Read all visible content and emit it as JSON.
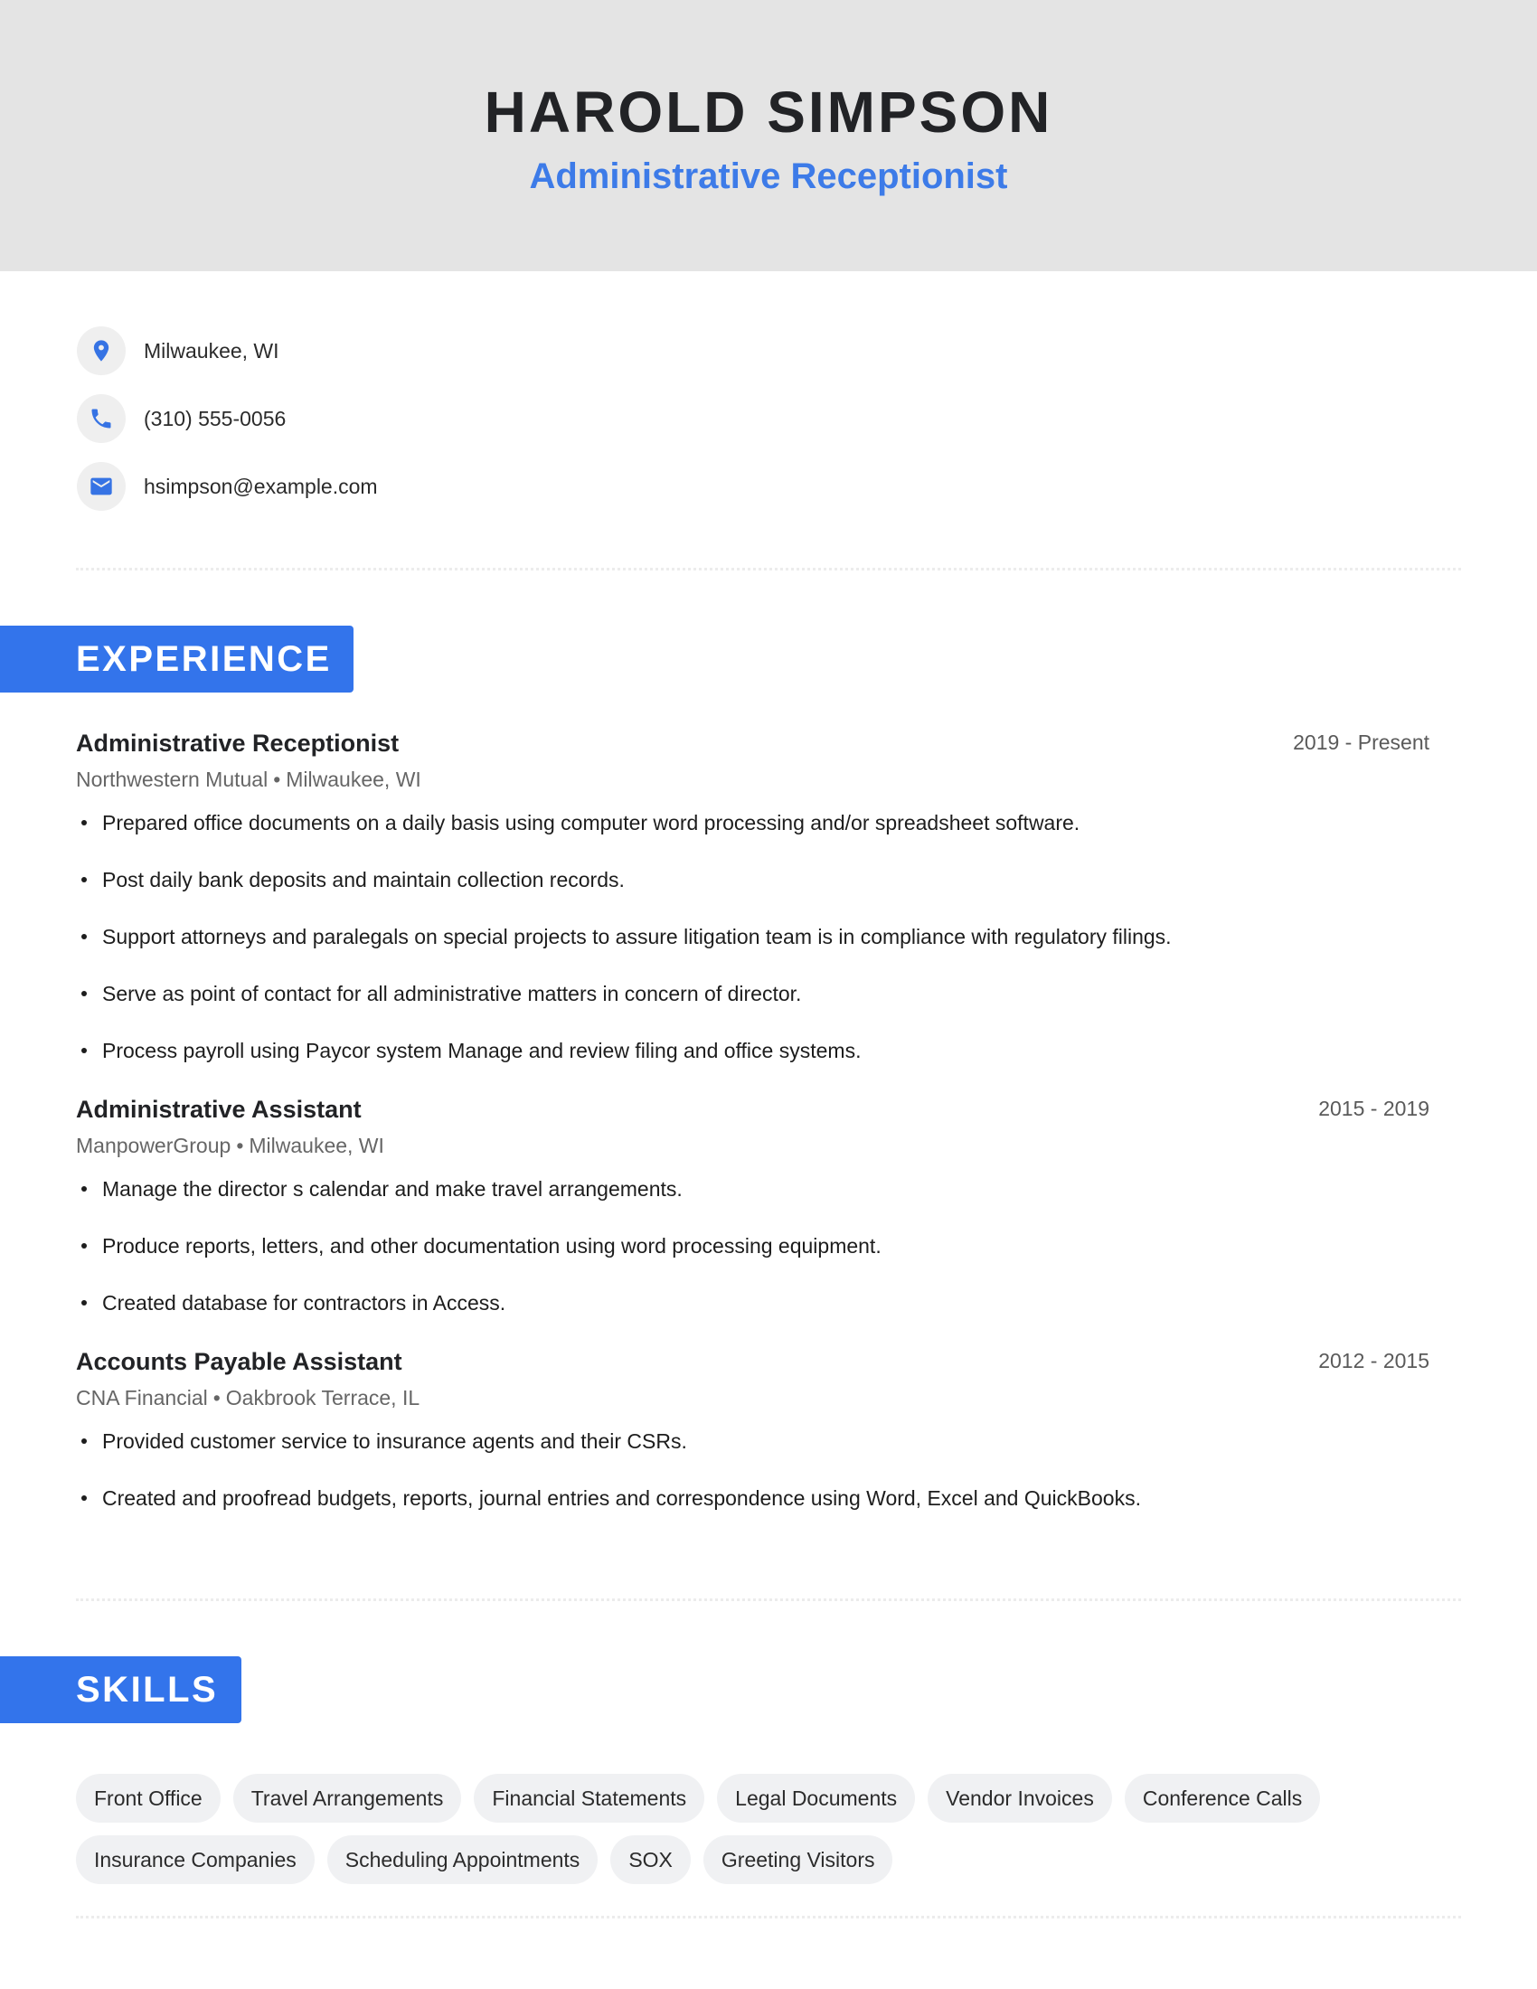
{
  "header": {
    "name": "HAROLD SIMPSON",
    "title": "Administrative Receptionist"
  },
  "contacts": [
    {
      "icon": "location-pin-icon",
      "text": "Milwaukee, WI"
    },
    {
      "icon": "phone-icon",
      "text": "(310) 555-0056"
    },
    {
      "icon": "mail-icon",
      "text": "hsimpson@example.com"
    }
  ],
  "colors": {
    "accent": "#3374eb",
    "header_bg": "#e4e4e4",
    "pill_bg": "#f0f1f3"
  },
  "experience": {
    "heading": "EXPERIENCE",
    "jobs": [
      {
        "title": "Administrative Receptionist",
        "date": "2019 - Present",
        "company": "Northwestern Mutual",
        "location": "Milwaukee, WI",
        "bullets": [
          "Prepared office documents on a daily basis using computer word processing and/or spreadsheet software.",
          "Post daily bank deposits and maintain collection records.",
          "Support attorneys and paralegals on special projects to assure litigation team is in compliance with regulatory filings.",
          "Serve as point of contact for all administrative matters in concern of director.",
          "Process payroll using Paycor system Manage and review filing and office systems."
        ]
      },
      {
        "title": "Administrative Assistant",
        "date": "2015 - 2019",
        "company": "ManpowerGroup",
        "location": "Milwaukee, WI",
        "bullets": [
          "Manage the director s calendar and make travel arrangements.",
          "Produce reports, letters, and other documentation using word processing equipment.",
          "Created database for contractors in Access."
        ]
      },
      {
        "title": "Accounts Payable Assistant",
        "date": "2012 - 2015",
        "company": "CNA Financial",
        "location": "Oakbrook Terrace, IL",
        "bullets": [
          "Provided customer service to insurance agents and their CSRs.",
          "Created and proofread budgets, reports, journal entries and correspondence using Word, Excel and QuickBooks."
        ]
      }
    ]
  },
  "skills": {
    "heading": "SKILLS",
    "items": [
      "Front Office",
      "Travel Arrangements",
      "Financial Statements",
      "Legal Documents",
      "Vendor Invoices",
      "Conference Calls",
      "Insurance Companies",
      "Scheduling Appointments",
      "SOX",
      "Greeting Visitors"
    ]
  },
  "separator": "•"
}
